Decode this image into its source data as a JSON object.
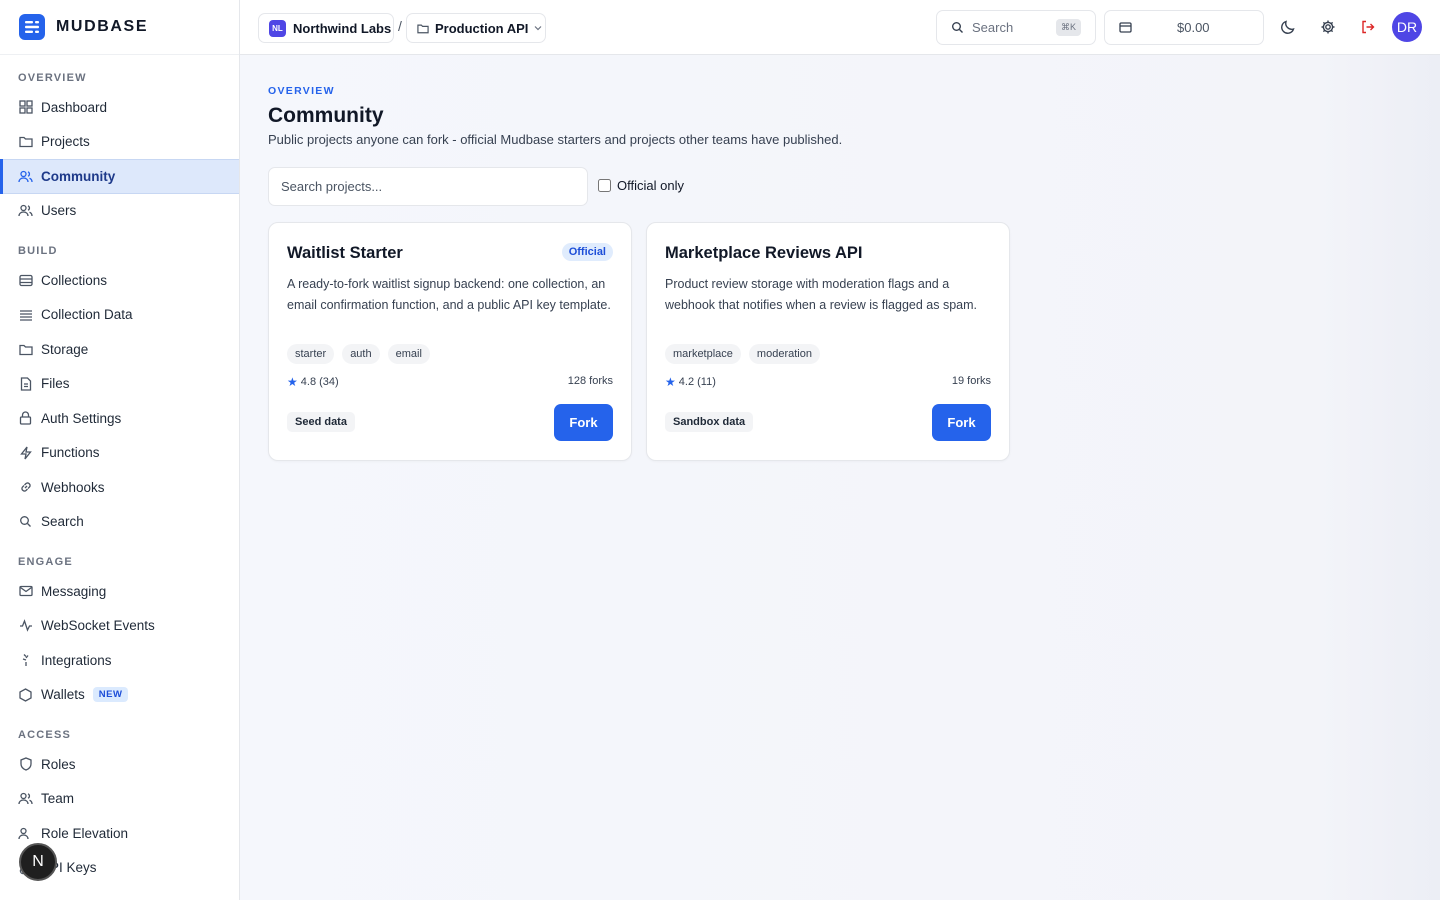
{
  "brand": {
    "name": "MUDBASE"
  },
  "sidebar": {
    "sections": [
      {
        "title": "OVERVIEW",
        "items": [
          {
            "label": "Dashboard",
            "icon": "grid-icon"
          },
          {
            "label": "Projects",
            "icon": "folder-icon"
          },
          {
            "label": "Community",
            "icon": "users-icon",
            "active": true
          },
          {
            "label": "Users",
            "icon": "users-icon"
          }
        ]
      },
      {
        "title": "BUILD",
        "items": [
          {
            "label": "Collections",
            "icon": "database-icon"
          },
          {
            "label": "Collection Data",
            "icon": "list-icon"
          },
          {
            "label": "Storage",
            "icon": "folder-icon"
          },
          {
            "label": "Files",
            "icon": "file-icon"
          },
          {
            "label": "Auth Settings",
            "icon": "lock-icon"
          },
          {
            "label": "Functions",
            "icon": "zap-icon"
          },
          {
            "label": "Webhooks",
            "icon": "link-icon"
          },
          {
            "label": "Search",
            "icon": "search-icon"
          }
        ]
      },
      {
        "title": "ENGAGE",
        "items": [
          {
            "label": "Messaging",
            "icon": "mail-icon"
          },
          {
            "label": "WebSocket Events",
            "icon": "activity-icon"
          },
          {
            "label": "Integrations",
            "icon": "plug-icon"
          },
          {
            "label": "Wallets",
            "icon": "hexagon-icon",
            "badge": "NEW"
          }
        ]
      },
      {
        "title": "ACCESS",
        "items": [
          {
            "label": "Roles",
            "icon": "shield-icon"
          },
          {
            "label": "Team",
            "icon": "users-icon"
          },
          {
            "label": "Role Elevation",
            "icon": "users-icon"
          },
          {
            "label": "API Keys",
            "icon": "key-icon"
          }
        ]
      }
    ]
  },
  "fab": {
    "label": "N"
  },
  "topbar": {
    "org": {
      "initials": "NL",
      "name": "Northwind Labs"
    },
    "separator": "/",
    "project": {
      "name": "Production API"
    },
    "search": {
      "label": "Search",
      "shortcut": "⌘K"
    },
    "wallet": {
      "amount": "$0.00"
    },
    "user": {
      "initials": "DR"
    }
  },
  "page": {
    "eyebrow": "OVERVIEW",
    "title": "Community",
    "description": "Public projects anyone can fork - official Mudbase starters and projects other teams have published.",
    "search_placeholder": "Search projects...",
    "filter_label": "Official only"
  },
  "cards": [
    {
      "title": "Waitlist Starter",
      "badge": "Official",
      "description": "A ready-to-fork waitlist signup backend: one collection, an email confirmation function, and a public API key template.",
      "tags": [
        "starter",
        "auth",
        "email"
      ],
      "rating": "4.8 (34)",
      "forks": "128 forks",
      "data_label": "Seed data",
      "action": "Fork"
    },
    {
      "title": "Marketplace Reviews API",
      "badge": "",
      "description": "Product review storage with moderation flags and a webhook that notifies when a review is flagged as spam.",
      "tags": [
        "marketplace",
        "moderation"
      ],
      "rating": "4.2 (11)",
      "forks": "19 forks",
      "data_label": "Sandbox data",
      "action": "Fork"
    }
  ],
  "colors": {
    "accent": "#2563eb",
    "active_bg": "#dde8fb",
    "logout": "#dc2626"
  }
}
